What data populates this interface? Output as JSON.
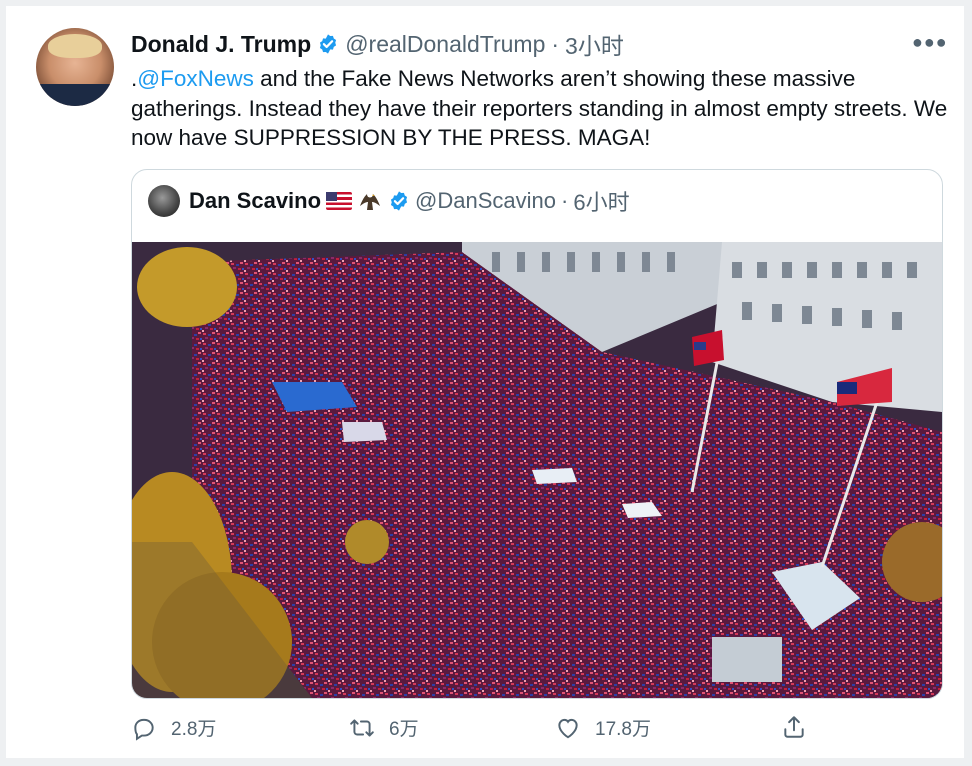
{
  "author": {
    "name": "Donald J. Trump",
    "handle": "@realDonaldTrump",
    "separator": "·",
    "time": "3小时",
    "more_icon": "more-horizontal-icon",
    "verified_color": "#1d9bf0"
  },
  "tweet": {
    "prefix": ".",
    "mention": "@FoxNews",
    "body": " and the Fake News Networks aren’t showing these massive gatherings. Instead they have their reporters standing in almost empty streets. We now have SUPPRESSION BY THE PRESS. MAGA!"
  },
  "quoted": {
    "name": "Dan Scavino",
    "handle": "@DanScavino",
    "separator": "·",
    "time": "6小时",
    "emojis": [
      "us-flag-emoji",
      "eagle-emoji"
    ],
    "photo": "aerial-crowd-rally-photo"
  },
  "actions": {
    "reply_count": "2.8万",
    "retweet_count": "6万",
    "like_count": "17.8万",
    "share_icon": "share-icon"
  },
  "colors": {
    "accent": "#1d9bf0",
    "text": "#0f1419",
    "secondary": "#536471",
    "border": "#cfd9de"
  }
}
